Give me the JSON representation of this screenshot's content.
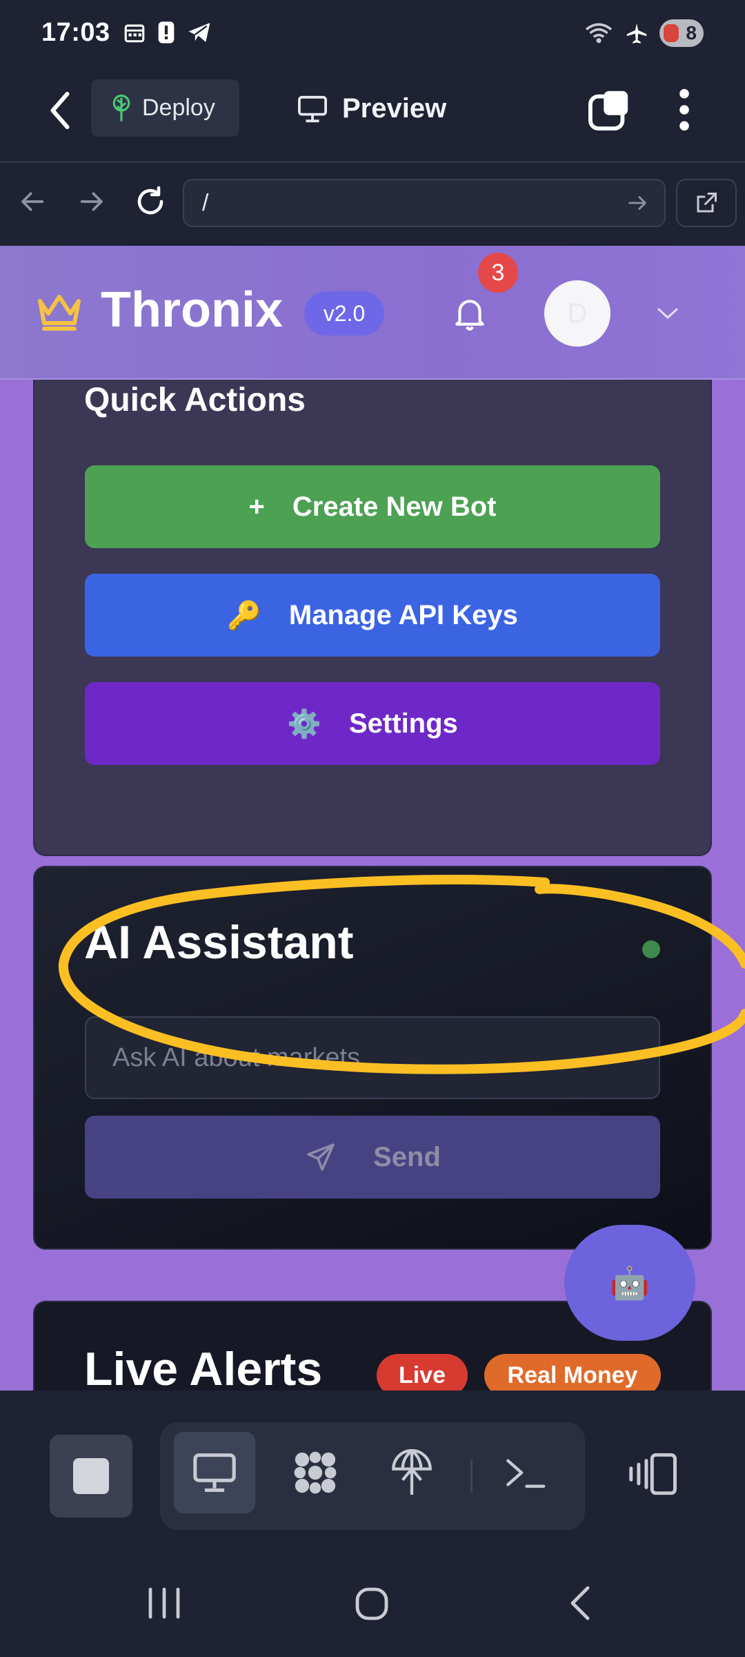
{
  "status_bar": {
    "time": "17:03",
    "battery": "8",
    "left_icons": [
      "calendar-icon",
      "alert-icon",
      "telegram-icon"
    ],
    "right_icons": [
      "wifi-icon",
      "airplane-icon",
      "battery-icon"
    ]
  },
  "toolbar": {
    "deploy_label": "Deploy",
    "preview_label": "Preview"
  },
  "urlbar": {
    "url": "/"
  },
  "site": {
    "brand": "Thronix",
    "version": "v2.0",
    "notification_count": "3",
    "avatar_initial": "D"
  },
  "quick_actions": {
    "title": "Quick Actions",
    "create_label": "Create New Bot",
    "create_icon": "+",
    "keys_label": "Manage API Keys",
    "keys_icon": "🔑",
    "settings_label": "Settings",
    "settings_icon": "⚙️"
  },
  "ai_assistant": {
    "title": "AI Assistant",
    "input_placeholder": "Ask AI about markets...",
    "send_label": "Send"
  },
  "fab": {
    "icon": "🤖"
  },
  "live_alerts": {
    "title": "Live Alerts",
    "live_badge": "Live",
    "money_badge": "Real Money"
  },
  "colors": {
    "create_green": "#4ca152",
    "keys_blue": "#3b64e3",
    "settings_purple": "#6f28c8",
    "highlight_yellow": "#fbbf24",
    "page_purple": "#9a6fd8"
  }
}
